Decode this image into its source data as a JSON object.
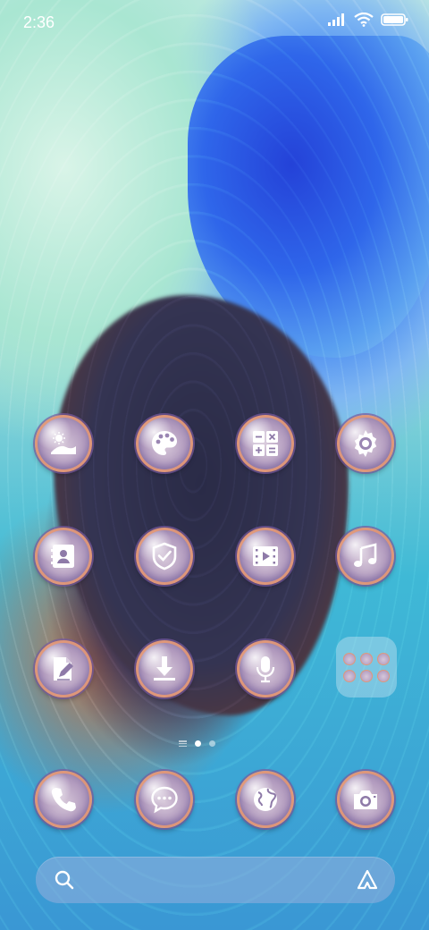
{
  "status_bar": {
    "time": "2:36",
    "icons": [
      "signal-icon",
      "wifi-icon",
      "battery-icon"
    ]
  },
  "apps": [
    {
      "name": "gallery",
      "icon": "landscape-icon"
    },
    {
      "name": "themes",
      "icon": "palette-icon"
    },
    {
      "name": "calculator",
      "icon": "calculator-icon"
    },
    {
      "name": "settings",
      "icon": "gear-icon"
    },
    {
      "name": "contacts",
      "icon": "contact-card-icon"
    },
    {
      "name": "security",
      "icon": "shield-check-icon"
    },
    {
      "name": "videos",
      "icon": "film-play-icon"
    },
    {
      "name": "music",
      "icon": "music-note-icon"
    },
    {
      "name": "notes",
      "icon": "note-pencil-icon"
    },
    {
      "name": "downloads",
      "icon": "download-icon"
    },
    {
      "name": "recorder",
      "icon": "microphone-icon"
    }
  ],
  "folder": {
    "name": "app-folder",
    "count": 6
  },
  "page_indicator": {
    "pages": 2,
    "active": 1
  },
  "dock": [
    {
      "name": "phone",
      "icon": "phone-icon"
    },
    {
      "name": "messages",
      "icon": "chat-bubble-icon"
    },
    {
      "name": "browser",
      "icon": "globe-icon"
    },
    {
      "name": "camera",
      "icon": "camera-icon"
    }
  ],
  "search_bar": {
    "icons": [
      "search-icon",
      "assistant-icon"
    ]
  },
  "colors": {
    "icon_ring": "#e6966e",
    "icon_body": "#b39cbf",
    "search_bar": "#96afdc"
  }
}
